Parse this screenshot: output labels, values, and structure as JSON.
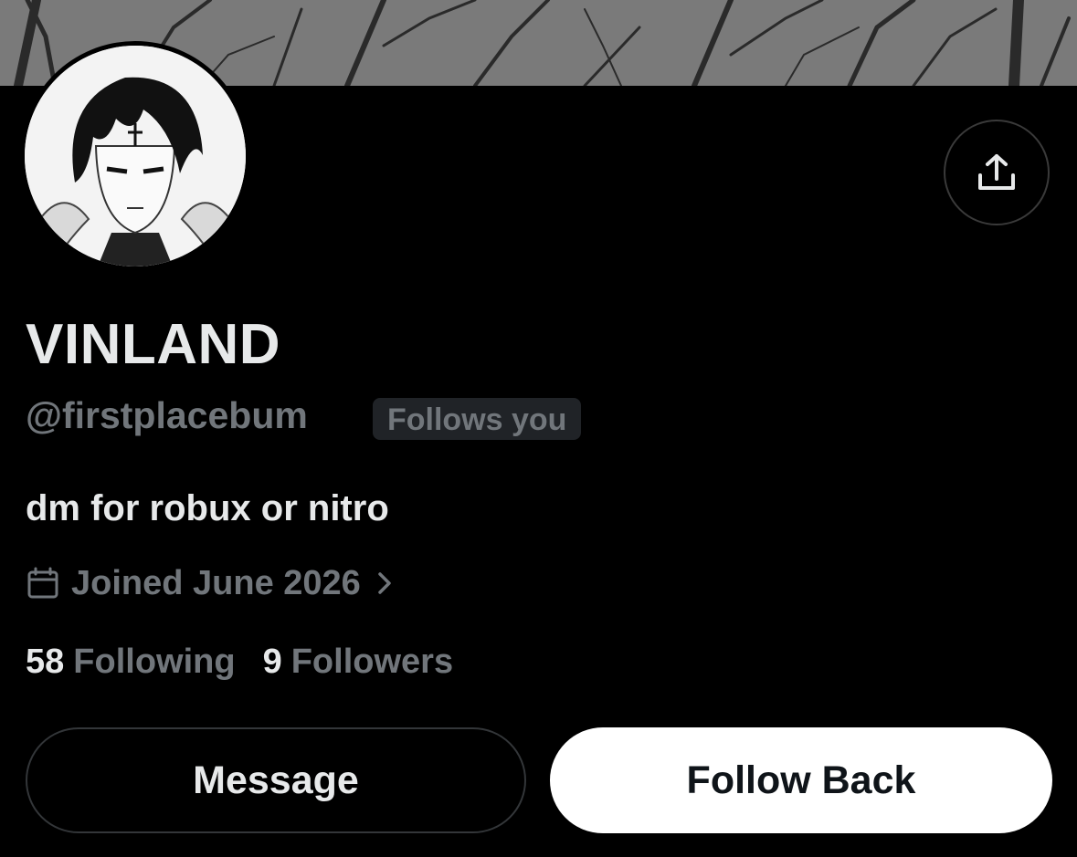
{
  "profile": {
    "display_name": "VINLAND",
    "handle": "@firstplacebum",
    "follows_you_badge": "Follows you",
    "bio": "dm for robux or nitro",
    "joined": "Joined June 2026",
    "following_count": "58",
    "following_label": "Following",
    "followers_count": "9",
    "followers_label": "Followers"
  },
  "actions": {
    "message_label": "Message",
    "follow_back_label": "Follow Back"
  },
  "icons": {
    "share": "share-icon",
    "calendar": "calendar-icon",
    "chevron": "chevron-right-icon"
  },
  "colors": {
    "background": "#000000",
    "primary_text": "#e7e9ea",
    "secondary_text": "#71767b",
    "badge_bg": "#202327",
    "follow_button_bg": "#ffffff",
    "follow_button_text": "#0f1419"
  }
}
